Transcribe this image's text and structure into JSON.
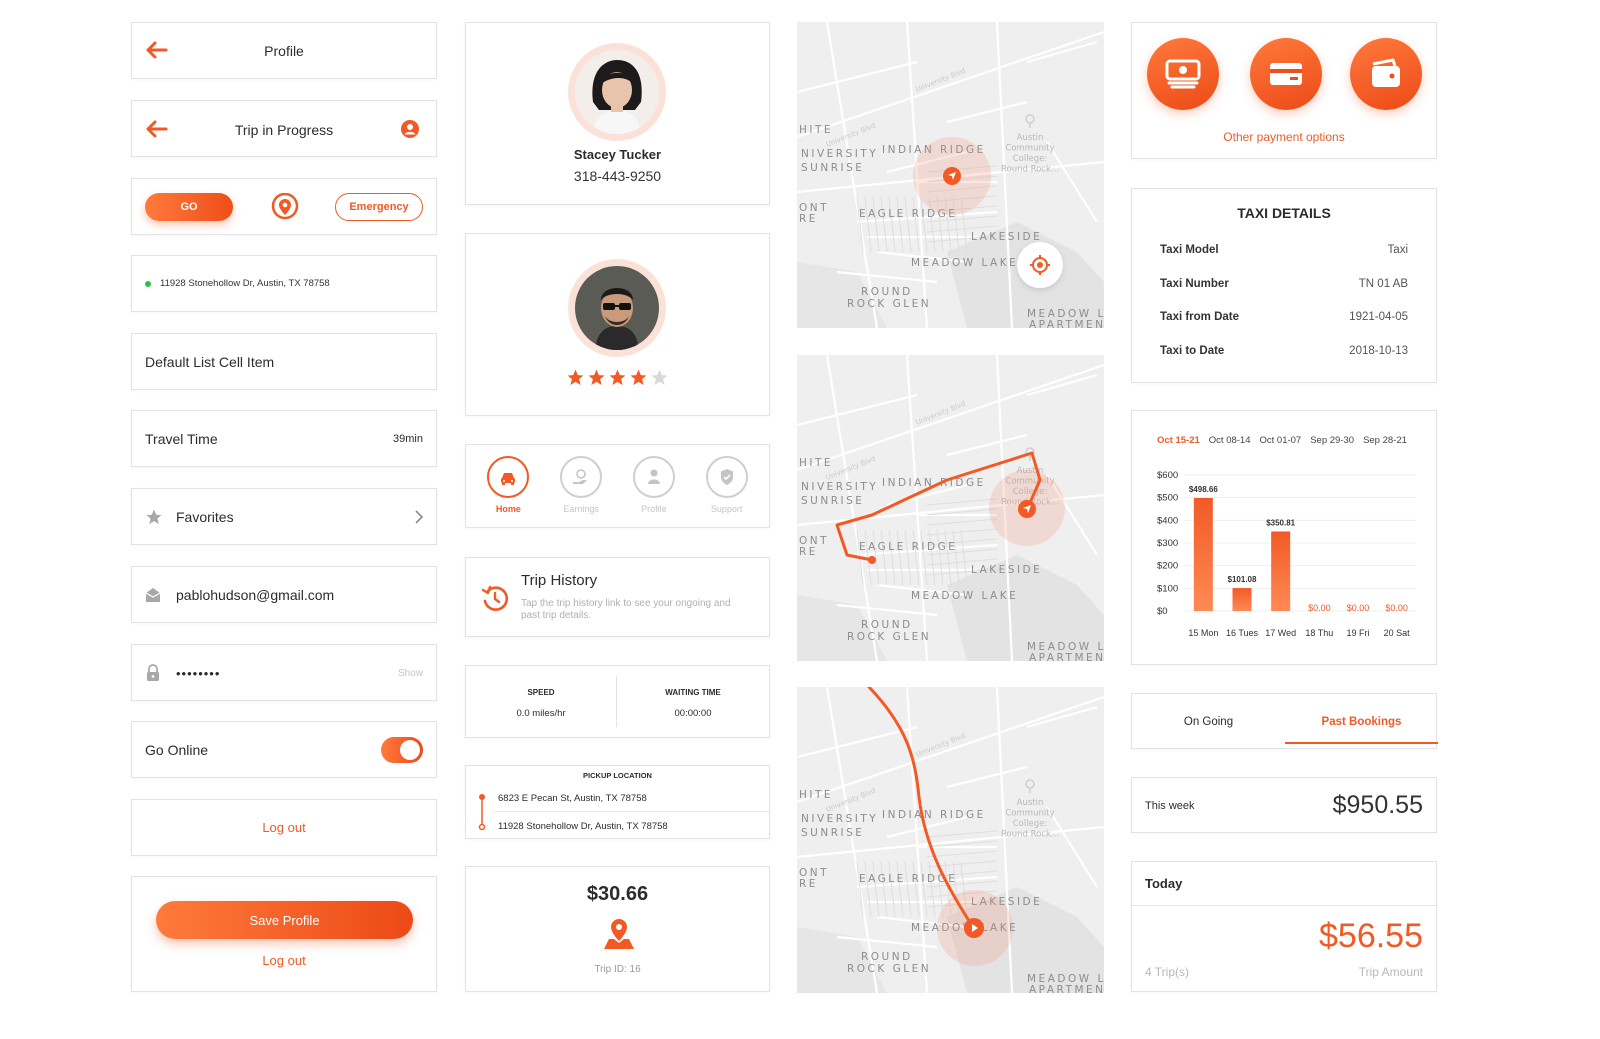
{
  "col1": {
    "profile_title": "Profile",
    "trip_title": "Trip in Progress",
    "go_label": "GO",
    "emergency_label": "Emergency",
    "address": "11928 Stonehollow Dr, Austin, TX 78758",
    "default_item": "Default List Cell Item",
    "travel_time_label": "Travel Time",
    "travel_time_value": "39min",
    "favorites_label": "Favorites",
    "email_value": "pablohudson@gmail.com",
    "password_value": "••••••••",
    "show_label": "Show",
    "go_online_label": "Go Online",
    "logout_label": "Log out",
    "save_profile_label": "Save Profile",
    "logout2_label": "Log out"
  },
  "col2": {
    "user_name": "Stacey Tucker",
    "user_phone": "318-443-9250",
    "rating": 4,
    "nav": [
      {
        "label": "Home",
        "icon": "car-icon",
        "active": true
      },
      {
        "label": "Earnings",
        "icon": "earnings-icon",
        "active": false
      },
      {
        "label": "Profile",
        "icon": "person-icon",
        "active": false
      },
      {
        "label": "Support",
        "icon": "shield-icon",
        "active": false
      }
    ],
    "trip_history_title": "Trip History",
    "trip_history_desc": "Tap the trip history link to see your ongoing and past trip details.",
    "speed_label": "SPEED",
    "speed_value": "0.0 miles/hr",
    "waiting_label": "WAITING TIME",
    "waiting_value": "00:00:00",
    "pickup_label": "PICKUP LOCATION",
    "pickup_from": "6823 E Pecan St, Austin, TX 78758",
    "pickup_to": "11928 Stonehollow Dr, Austin, TX 78758",
    "fare": "$30.66",
    "trip_id": "Trip ID: 16"
  },
  "maps": {
    "labels": [
      "NIVERSITY",
      "SUNRISE",
      "INDIAN RIDGE",
      "EAGLE RIDGE",
      "LAKESIDE",
      "MEADOW LAKE",
      "ROUND",
      "ROCK GLEN",
      "MEADOW LA",
      "APARTMEN",
      "HITE",
      "ONT",
      "RE"
    ],
    "poi_lines": [
      "Austin",
      "Community",
      "College:",
      "Round Rock..."
    ],
    "street1": "University Blvd",
    "street2": "University Blvd"
  },
  "col4": {
    "other_payment": "Other payment options",
    "taxi_title": "TAXI DETAILS",
    "taxi_details": [
      {
        "k": "Taxi Model",
        "v": "Taxi"
      },
      {
        "k": "Taxi Number",
        "v": "TN 01 AB"
      },
      {
        "k": "Taxi from Date",
        "v": "1921-04-05"
      },
      {
        "k": "Taxi to Date",
        "v": "2018-10-13"
      }
    ],
    "week_tabs": [
      "Oct 15-21",
      "Oct 08-14",
      "Oct 01-07",
      "Sep 29-30",
      "Sep 28-21"
    ],
    "tab_ongoing": "On Going",
    "tab_past": "Past Bookings",
    "this_week_label": "This week",
    "this_week_value": "$950.55",
    "today_label": "Today",
    "today_value": "$56.55",
    "trips_label": "4 Trip(s)",
    "trip_amount_label": "Trip Amount"
  },
  "chart_data": {
    "type": "bar",
    "categories": [
      "15 Mon",
      "16 Tues",
      "17 Wed",
      "18 Thu",
      "19 Fri",
      "20 Sat"
    ],
    "values": [
      498.66,
      101.08,
      350.81,
      0,
      0,
      0
    ],
    "data_labels": [
      "$498.66",
      "$101.08",
      "$350.81",
      "$0.00",
      "$0.00",
      "$0.00"
    ],
    "yticks": [
      "$0",
      "$100",
      "$200",
      "$300",
      "$400",
      "$500",
      "$600"
    ],
    "ylim": [
      0,
      600
    ],
    "grid": true,
    "bar_color": "#f25a25"
  }
}
